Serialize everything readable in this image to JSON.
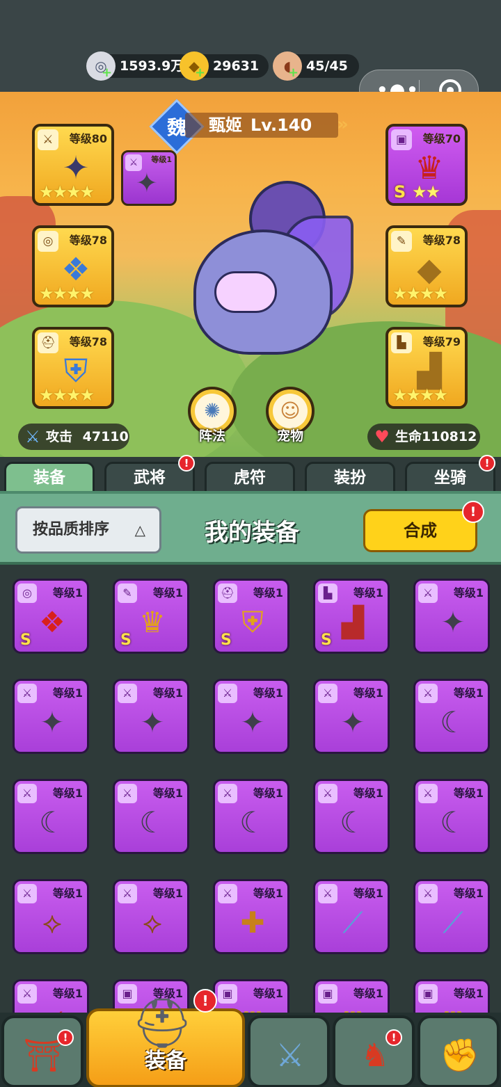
{
  "resources": {
    "silver": "1593.9万",
    "gold": "29631",
    "stamina": "45/45"
  },
  "hero": {
    "kingdom": "魏",
    "name": "甄姬",
    "level": "Lv.140",
    "attack_label": "攻击",
    "attack_value": "47110",
    "hp_label": "生命",
    "hp_value": "110812",
    "formation_label": "阵法",
    "pet_label": "宠物"
  },
  "equipped": {
    "weapon": {
      "level": "等级80",
      "icon": "sword-tag",
      "stars": 4
    },
    "armor": {
      "level": "等级70",
      "icon": "armor-tag",
      "grade": "S",
      "stars": 2
    },
    "necklace": {
      "level": "等级78",
      "icon": "medal-tag",
      "stars": 4
    },
    "bracer": {
      "level": "等级78",
      "icon": "scroll-tag",
      "stars": 4
    },
    "helmet": {
      "level": "等级78",
      "icon": "helmet-tag",
      "stars": 4
    },
    "boots": {
      "level": "等级79",
      "icon": "boot-tag",
      "stars": 4
    },
    "extra": {
      "level": "等级1"
    }
  },
  "tabs": [
    {
      "label": "装备",
      "active": true,
      "badge": false
    },
    {
      "label": "武将",
      "active": false,
      "badge": true
    },
    {
      "label": "虎符",
      "active": false,
      "badge": false
    },
    {
      "label": "装扮",
      "active": false,
      "badge": false
    },
    {
      "label": "坐骑",
      "active": false,
      "badge": true
    }
  ],
  "panel": {
    "sort_label": "按品质排序",
    "title": "我的装备",
    "merge_label": "合成"
  },
  "inventory": [
    {
      "level": "等级1",
      "tag": "medal",
      "item": "necklace",
      "grade": "S"
    },
    {
      "level": "等级1",
      "tag": "scroll",
      "item": "bracer",
      "grade": "S"
    },
    {
      "level": "等级1",
      "tag": "helmet",
      "item": "helmet",
      "grade": "S"
    },
    {
      "level": "等级1",
      "tag": "boot",
      "item": "boots",
      "grade": "S"
    },
    {
      "level": "等级1",
      "tag": "sword",
      "item": "shuriken",
      "grade": ""
    },
    {
      "level": "等级1",
      "tag": "sword",
      "item": "shuriken",
      "grade": ""
    },
    {
      "level": "等级1",
      "tag": "sword",
      "item": "shuriken",
      "grade": ""
    },
    {
      "level": "等级1",
      "tag": "sword",
      "item": "shuriken",
      "grade": ""
    },
    {
      "level": "等级1",
      "tag": "sword",
      "item": "shuriken",
      "grade": ""
    },
    {
      "level": "等级1",
      "tag": "sword",
      "item": "dagger",
      "grade": ""
    },
    {
      "level": "等级1",
      "tag": "sword",
      "item": "dagger",
      "grade": ""
    },
    {
      "level": "等级1",
      "tag": "sword",
      "item": "dagger",
      "grade": ""
    },
    {
      "level": "等级1",
      "tag": "sword",
      "item": "dagger",
      "grade": ""
    },
    {
      "level": "等级1",
      "tag": "sword",
      "item": "dagger",
      "grade": ""
    },
    {
      "level": "等级1",
      "tag": "sword",
      "item": "dagger",
      "grade": ""
    },
    {
      "level": "等级1",
      "tag": "sword",
      "item": "crossbow",
      "grade": ""
    },
    {
      "level": "等级1",
      "tag": "sword",
      "item": "crossbow",
      "grade": ""
    },
    {
      "level": "等级1",
      "tag": "sword",
      "item": "gun",
      "grade": ""
    },
    {
      "level": "等级1",
      "tag": "sword",
      "item": "glaive",
      "grade": ""
    },
    {
      "level": "等级1",
      "tag": "sword",
      "item": "glaive",
      "grade": ""
    },
    {
      "level": "等级1",
      "tag": "sword",
      "item": "spear",
      "grade": ""
    },
    {
      "level": "等级1",
      "tag": "armor",
      "item": "armor",
      "grade": ""
    },
    {
      "level": "等级1",
      "tag": "armor",
      "item": "armor",
      "grade": ""
    },
    {
      "level": "等级1",
      "tag": "armor",
      "item": "armor",
      "grade": ""
    },
    {
      "level": "等级1",
      "tag": "armor",
      "item": "armor",
      "grade": ""
    }
  ],
  "bottom_nav": {
    "active_label": "装备",
    "items": [
      {
        "name": "shop",
        "badge": true
      },
      {
        "name": "equipment",
        "badge": true
      },
      {
        "name": "battle",
        "badge": false
      },
      {
        "name": "heroes",
        "badge": true
      },
      {
        "name": "upgrade",
        "badge": false
      }
    ]
  }
}
